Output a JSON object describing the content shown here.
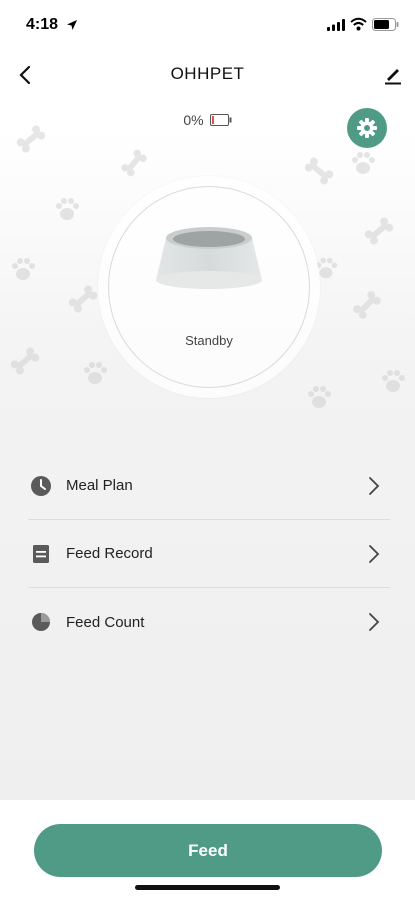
{
  "status_bar": {
    "time": "4:18",
    "icons": [
      "location-arrow-icon",
      "signal-icon",
      "wifi-icon",
      "battery-icon"
    ]
  },
  "header": {
    "title": "OHHPET",
    "back_icon": "chevron-left-icon",
    "edit_icon": "edit-pencil-icon"
  },
  "device": {
    "food_level": "0%",
    "food_level_icon": "battery-empty-icon",
    "status": "Standby",
    "settings_icon": "gear-icon"
  },
  "menu": {
    "items": [
      {
        "label": "Meal Plan",
        "icon": "clock-icon"
      },
      {
        "label": "Feed Record",
        "icon": "document-icon"
      },
      {
        "label": "Feed Count",
        "icon": "pie-chart-icon"
      }
    ]
  },
  "footer": {
    "feed_label": "Feed"
  },
  "colors": {
    "accent": "#4f9b86",
    "battery_low": "#d9534f"
  }
}
